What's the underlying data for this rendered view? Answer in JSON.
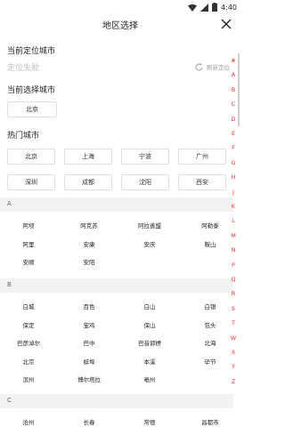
{
  "status": {
    "time": "4:40"
  },
  "header": {
    "title": "地区选择"
  },
  "location": {
    "title": "当前定位城市",
    "status": "定位失败",
    "relocate": "刷新定位"
  },
  "selected": {
    "title": "当前选择城市",
    "city": "北京"
  },
  "hot": {
    "title": "热门城市",
    "cities": [
      "北京",
      "上海",
      "宁波",
      "广州",
      "深圳",
      "成都",
      "沈阳",
      "西安"
    ]
  },
  "sections": [
    {
      "letter": "A",
      "cities": [
        "阿坝",
        "阿克苏",
        "阿拉善盟",
        "阿勒泰",
        "阿里",
        "安康",
        "安庆",
        "鞍山",
        "安顺",
        "安阳"
      ]
    },
    {
      "letter": "B",
      "cities": [
        "白城",
        "百色",
        "白山",
        "白银",
        "保定",
        "宝鸡",
        "保山",
        "包头",
        "巴彦淖尔",
        "巴中",
        "巴音郭楞",
        "北海",
        "北京",
        "蚌埠",
        "本溪",
        "毕节",
        "滨州",
        "博尔塔拉",
        "亳州"
      ]
    },
    {
      "letter": "C",
      "cities": [
        "沧州",
        "长春",
        "常德",
        "昌都市"
      ]
    }
  ],
  "index": [
    "#",
    "A",
    "B",
    "C",
    "D",
    "E",
    "F",
    "G",
    "H",
    "J",
    "K",
    "L",
    "M",
    "N",
    "P",
    "Q",
    "R",
    "S",
    "T",
    "W",
    "X",
    "Y",
    "Z"
  ],
  "colors": {
    "accent": "#e53935",
    "header_bg": "#f2f2f2",
    "border": "#e0e0e0"
  }
}
